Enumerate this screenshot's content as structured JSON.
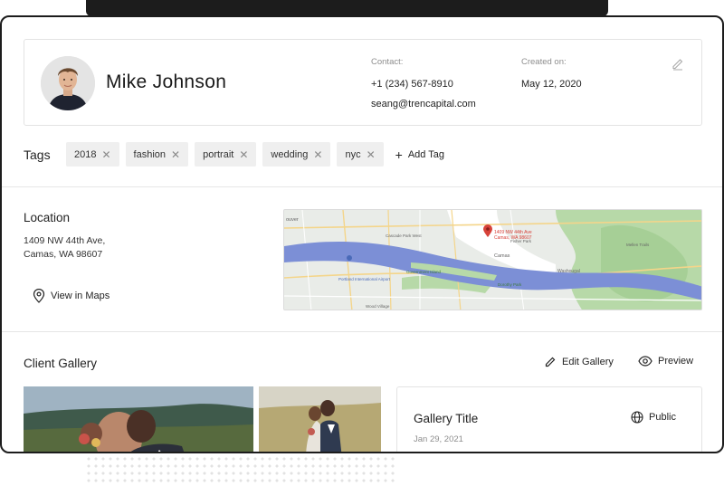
{
  "profile": {
    "name": "Mike Johnson",
    "contact_label": "Contact:",
    "phone": "+1 (234) 567-8910",
    "email": "seang@trencapital.com",
    "created_label": "Created on:",
    "created_date": "May 12, 2020"
  },
  "tags": {
    "title": "Tags",
    "items": [
      {
        "label": "2018"
      },
      {
        "label": "fashion"
      },
      {
        "label": "portrait"
      },
      {
        "label": "wedding"
      },
      {
        "label": "nyc"
      }
    ],
    "remove_glyph": "✕",
    "add_label": "Add Tag"
  },
  "location": {
    "title": "Location",
    "address_line1": "1409 NW 44th Ave,",
    "address_line2": "Camas, WA 98607",
    "view_maps_label": "View in Maps",
    "map": {
      "pin_line1": "1409 NW 44th Ave",
      "pin_line2": "Camas, WA 98607",
      "places": [
        "ouver",
        "Cascade Park West",
        "Camas",
        "Portland International Airport",
        "Government Island",
        "Fisher Park",
        "Washougal",
        "Wood Village",
        "Mellen Trails",
        "Dorothy Park"
      ],
      "colors": {
        "water": "#7c8fd6",
        "land": "#e9ece8",
        "park": "#b7d9a8",
        "road": "#f4d58a",
        "pin": "#d7423a"
      }
    }
  },
  "gallery": {
    "title": "Client Gallery",
    "edit_label": "Edit Gallery",
    "preview_label": "Preview",
    "card_title": "Gallery Title",
    "card_date": "Jan 29, 2021",
    "visibility_label": "Public"
  },
  "icons": {
    "edit": "pencil-icon",
    "remove_tag": "close-icon",
    "add": "plus-icon",
    "location": "map-pin-icon",
    "edit_gallery": "pencil-icon",
    "preview": "eye-icon",
    "visibility": "globe-icon"
  }
}
